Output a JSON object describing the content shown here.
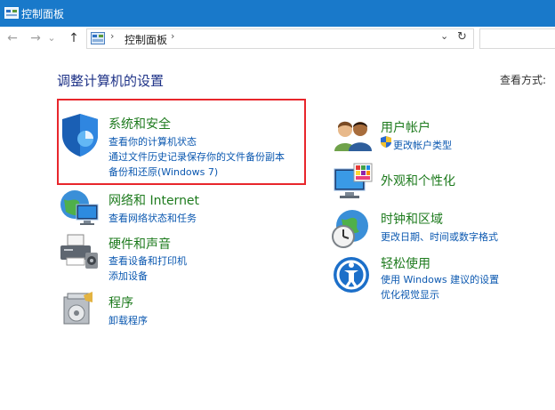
{
  "window": {
    "title": "控制面板"
  },
  "nav": {
    "back_glyph": "←",
    "forward_glyph": "→",
    "recent_glyph": "⌄",
    "up_glyph": "↑",
    "breadcrumb_sep": "›",
    "breadcrumb": "控制面板",
    "breadcrumb_end_sep": "›",
    "dropdown_glyph": "⌄",
    "refresh_glyph": "↻"
  },
  "main": {
    "heading": "调整计算机的设置",
    "view_by": "查看方式:",
    "categories": [
      {
        "title": "系统和安全",
        "links": [
          "查看你的计算机状态",
          "通过文件历史记录保存你的文件备份副本",
          "备份和还原(Windows 7)"
        ]
      },
      {
        "title": "网络和 Internet",
        "links": [
          "查看网络状态和任务"
        ]
      },
      {
        "title": "硬件和声音",
        "links": [
          "查看设备和打印机",
          "添加设备"
        ]
      },
      {
        "title": "程序",
        "links": [
          "卸载程序"
        ]
      },
      {
        "title": "用户帐户",
        "links": [
          "更改帐户类型"
        ]
      },
      {
        "title": "外观和个性化",
        "links": []
      },
      {
        "title": "时钟和区域",
        "links": [
          "更改日期、时间或数字格式"
        ]
      },
      {
        "title": "轻松使用",
        "links": [
          "使用 Windows 建议的设置",
          "优化视觉显示"
        ]
      }
    ]
  },
  "colors": {
    "titlebar": "#1979ca",
    "heading": "#1e3287",
    "category": "#1e7b1e",
    "link": "#0b58b0",
    "highlight": "#e8262c"
  }
}
